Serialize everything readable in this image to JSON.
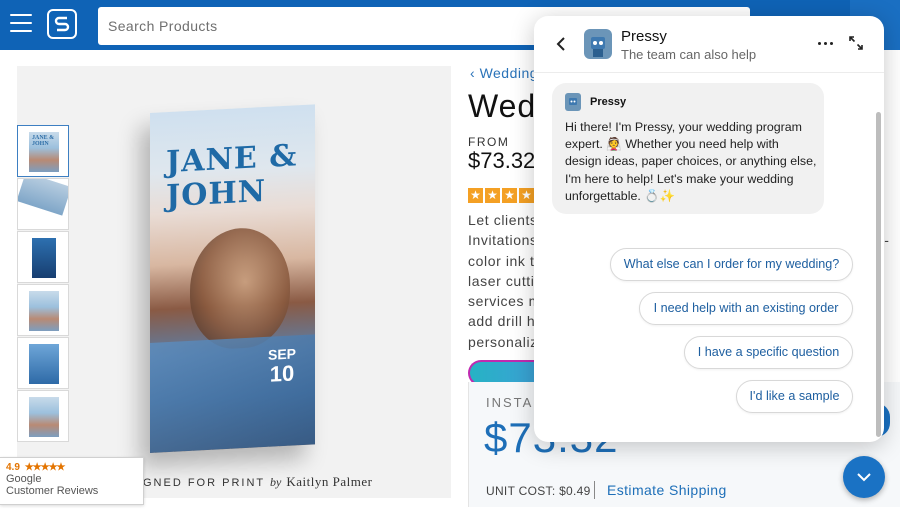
{
  "header": {
    "search_placeholder": "Search Products",
    "icons": [
      "menu-icon",
      "logo-icon"
    ]
  },
  "gallery": {
    "card_names": "JANE &\nJOHN",
    "card_month": "SEP",
    "card_day": "10",
    "designed_prefix": "GNED FOR PRINT",
    "designed_by": "by",
    "designed_author": "Kaitlyn Palmer",
    "thumb_text": "JANE & JOHN"
  },
  "google_badge": {
    "rating": "4.9",
    "stars": "★★★★★",
    "brand": "Google",
    "label": "Customer Reviews"
  },
  "product": {
    "breadcrumb": "Wedding",
    "title": "Wedding",
    "from_label": "FROM",
    "price": "$73.32",
    "rating_stars": 5,
    "description_lines": [
      "Let clients",
      "Invitations",
      "color ink to",
      "laser cutti",
      "services m",
      "add drill h",
      "personaliz"
    ],
    "description_right": [
      "ll-",
      "l"
    ],
    "instant_label": "INSTAN",
    "big_price": "$73.32",
    "unit_cost": "UNIT COST: $0.49",
    "estimate_shipping": "Estimate Shipping"
  },
  "chat": {
    "bot_name": "Pressy",
    "subtitle": "The team can also help",
    "message_sender": "Pressy",
    "message": "Hi there! I'm Pressy, your wedding program expert. 👰 Whether you need help with design ideas, paper choices, or anything else, I'm here to help! Let's make your wedding unforgettable. 💍✨",
    "suggestions": [
      "What else can I order for my wedding?",
      "I need help with an existing order",
      "I have a specific question",
      "I'd like a sample"
    ]
  },
  "colors": {
    "brand_blue": "#0f63b6",
    "link_blue": "#1e6fb8",
    "star_orange": "#f4a024"
  }
}
